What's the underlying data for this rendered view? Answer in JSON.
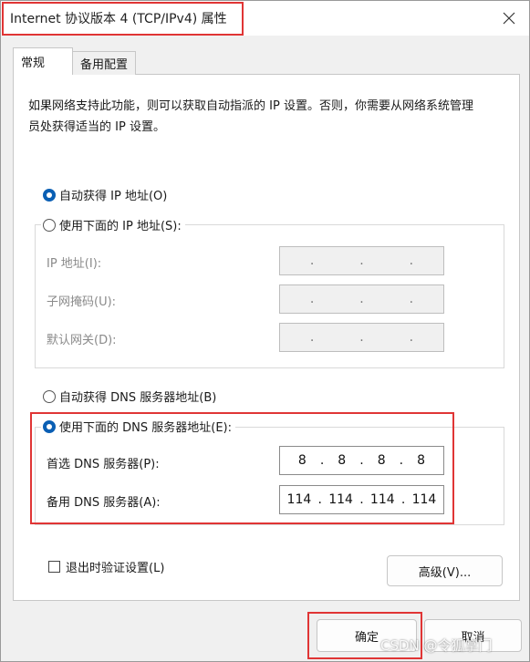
{
  "window": {
    "title": "Internet 协议版本 4 (TCP/IPv4) 属性",
    "close_icon": "close-icon"
  },
  "tabs": [
    {
      "label": "常规",
      "active": true
    },
    {
      "label": "备用配置",
      "active": false
    }
  ],
  "description": "如果网络支持此功能，则可以获取自动指派的 IP 设置。否则，你需要从网络系统管理员处获得适当的 IP 设置。",
  "ip_section": {
    "auto_label": "自动获得 IP 地址(O)",
    "auto_selected": true,
    "manual_label": "使用下面的 IP 地址(S):",
    "manual_selected": false,
    "fields": [
      {
        "label": "IP 地址(I):",
        "value": [
          ".",
          ".",
          "."
        ]
      },
      {
        "label": "子网掩码(U):",
        "value": [
          ".",
          ".",
          "."
        ]
      },
      {
        "label": "默认网关(D):",
        "value": [
          ".",
          ".",
          "."
        ]
      }
    ]
  },
  "dns_section": {
    "auto_label": "自动获得 DNS 服务器地址(B)",
    "auto_selected": false,
    "manual_label": "使用下面的 DNS 服务器地址(E):",
    "manual_selected": true,
    "preferred": {
      "label": "首选 DNS 服务器(P):",
      "octets": [
        "8",
        "8",
        "8",
        "8"
      ]
    },
    "alternate": {
      "label": "备用 DNS 服务器(A):",
      "octets": [
        "114",
        "114",
        "114",
        "114"
      ]
    }
  },
  "validate_on_exit": {
    "label": "退出时验证设置(L)",
    "checked": false
  },
  "advanced_button": "高级(V)...",
  "ok_button": "确定",
  "cancel_button": "取消",
  "watermark": "CSDN @令狐掌门",
  "colors": {
    "highlight": "#e03535",
    "radio_selected": "#0a5fb4"
  }
}
